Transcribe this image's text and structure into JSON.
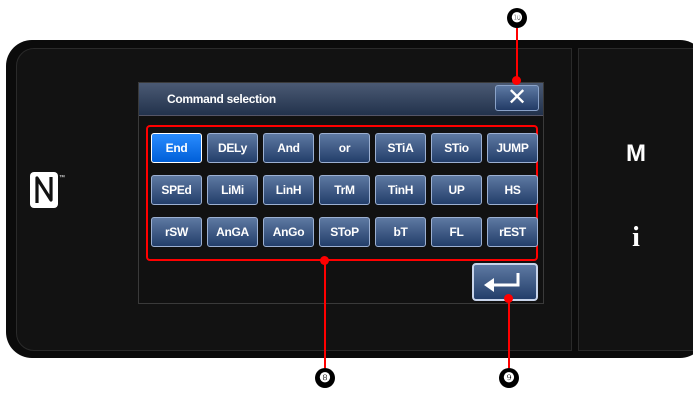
{
  "dialog": {
    "title": "Command selection",
    "close_glyph": "✕",
    "enter_icon": "enter-arrow-icon"
  },
  "commands": [
    {
      "label": "End",
      "selected": true
    },
    {
      "label": "DELy"
    },
    {
      "label": "And"
    },
    {
      "label": "or"
    },
    {
      "label": "STiA"
    },
    {
      "label": "STio"
    },
    {
      "label": "JUMP"
    },
    {
      "label": "SPEd"
    },
    {
      "label": "LiMi"
    },
    {
      "label": "LinH"
    },
    {
      "label": "TrM"
    },
    {
      "label": "TinH"
    },
    {
      "label": "UP"
    },
    {
      "label": "HS"
    },
    {
      "label": "rSW"
    },
    {
      "label": "AnGA"
    },
    {
      "label": "AnGo"
    },
    {
      "label": "SToP"
    },
    {
      "label": "bT"
    },
    {
      "label": "FL"
    },
    {
      "label": "rEST"
    }
  ],
  "side": {
    "mode_label": "M",
    "info_label": "i"
  },
  "callouts": {
    "close": "❿",
    "grid": "❽",
    "enter": "❾"
  },
  "colors": {
    "selected": "#0a75f5",
    "button": "#2c4a78",
    "callout_line": "#ff0000"
  }
}
